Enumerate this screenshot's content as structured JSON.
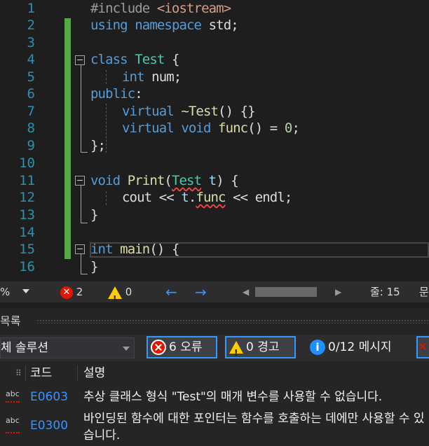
{
  "editor": {
    "line_numbers": [
      "1",
      "2",
      "3",
      "4",
      "5",
      "6",
      "7",
      "8",
      "9",
      "10",
      "11",
      "12",
      "13",
      "14",
      "15",
      "16"
    ],
    "lines": {
      "l1": {
        "kw": "#include",
        "str": "<iostream>"
      },
      "l2": {
        "kw1": "using",
        "kw2": "namespace",
        "rest": " std;"
      },
      "l4": {
        "kw": "class",
        "ty": "Test",
        "rest": " {"
      },
      "l5": {
        "kw": "int",
        "rest": " num;"
      },
      "l6": {
        "kw": "public",
        "rest": ":"
      },
      "l7": {
        "kw": "virtual",
        "fn": "~Test",
        "rest": "() {}"
      },
      "l8": {
        "kw1": "virtual",
        "kw2": "void",
        "fn": "func",
        "mid": "() = ",
        "num": "0",
        "end": ";"
      },
      "l9": {
        "rest": "};"
      },
      "l11": {
        "kw": "void",
        "fn": "Print",
        "p1": "(",
        "ty": "Test",
        "var": "t",
        "rest": ") {"
      },
      "l12": {
        "a": "cout << ",
        "var": "t",
        "dot": ".",
        "fn": "func",
        "b": " << endl;"
      },
      "l13": {
        "rest": "}"
      },
      "l15": {
        "kw": "int",
        "fn": "main",
        "rest": "() {"
      },
      "l16": {
        "rest": "}"
      }
    }
  },
  "statusbar": {
    "zoom": "%",
    "error_count": "2",
    "warning_count": "0",
    "line_label": "줄: 15",
    "col_label": "문"
  },
  "error_list": {
    "title": "목록",
    "scope": "체 솔루션",
    "errors_label": "6 오류",
    "warnings_label": "0 경고",
    "messages_label": "0/12 메시지",
    "columns": {
      "code": "코드",
      "description": "설명"
    },
    "rows": [
      {
        "code": "E0603",
        "description": "추상 클래스 형식 \"Test\"의 매개 변수를 사용할 수 없습니다."
      },
      {
        "code": "E0300",
        "description": "바인딩된 함수에 대한 포인터는 함수를 호출하는 데에만 사용할 수 있습니다."
      }
    ]
  },
  "colors": {
    "error": "#e51400",
    "warning": "#ffcc00",
    "info": "#1e90ff",
    "accent": "#3399ff",
    "changed": "#57a64a"
  }
}
